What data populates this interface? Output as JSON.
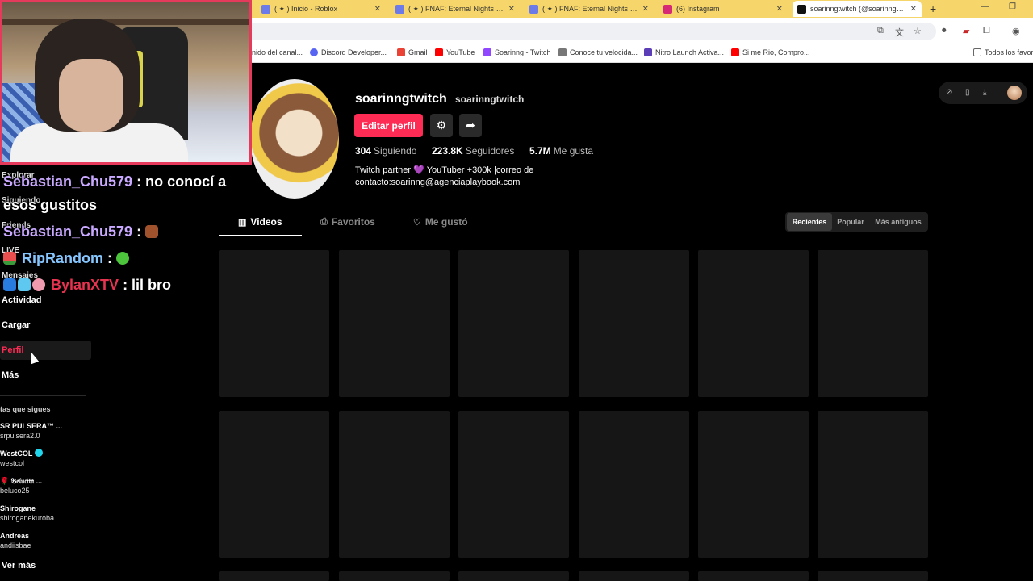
{
  "browser": {
    "tabs": [
      {
        "title": "( ✦ ) Inicio - Roblox",
        "color": "#6c7be8",
        "active": false
      },
      {
        "title": "( ✦ ) FNAF: Eternal Nights 🦇 - ",
        "color": "#6c7be8",
        "active": false
      },
      {
        "title": "( ✦ ) FNAF: Eternal Nights 🦇 - ",
        "color": "#6c7be8",
        "active": false
      },
      {
        "title": "(6) Instagram",
        "color": "#d62976",
        "active": false
      },
      {
        "title": "soarinngtwitch (@soarinngtwit",
        "color": "#111111",
        "active": true
      }
    ],
    "new_tab": "+",
    "bookmarks": [
      {
        "label": "nido del canal...",
        "color": "#ffffff"
      },
      {
        "label": "Discord Developer...",
        "color": "#5865f2"
      },
      {
        "label": "Gmail",
        "color": "#ea4335"
      },
      {
        "label": "YouTube",
        "color": "#ff0000"
      },
      {
        "label": "Soarinng - Twitch",
        "color": "#9146ff"
      },
      {
        "label": "Conoce tu velocida...",
        "color": "#777777"
      },
      {
        "label": "Nitro Launch Activa...",
        "color": "#5b3db8"
      },
      {
        "label": "Si me Rio, Compro...",
        "color": "#ff0000"
      },
      {
        "label": "Todos los favori",
        "color": "#777777"
      }
    ]
  },
  "chat": [
    {
      "user": "Sebastian_Chu579",
      "text": ": no conocí a",
      "color": "purple"
    },
    {
      "user": "",
      "text": "esos gustitos",
      "color": "purple"
    },
    {
      "user": "Sebastian_Chu579",
      "text": ":",
      "color": "purple"
    },
    {
      "user": "RipRandom",
      "text": ":",
      "color": "blue"
    },
    {
      "user": "BylanXTV",
      "text": ": lil bro",
      "color": "red"
    }
  ],
  "sidebar": {
    "items": [
      {
        "label": "Explorar"
      },
      {
        "label": "Siguiendo"
      },
      {
        "label": "Friends"
      },
      {
        "label": "LIVE"
      },
      {
        "label": "Mensajes"
      },
      {
        "label": "Actividad"
      },
      {
        "label": "Cargar"
      },
      {
        "label": "Perfil"
      },
      {
        "label": "Más"
      }
    ],
    "following_title": "tas que sigues",
    "following": [
      {
        "name": "SR PULSERA™ ...",
        "handle": "srpulsera2.0"
      },
      {
        "name": "WestCOL",
        "handle": "westcol"
      },
      {
        "name": "🌹 𝔅𝔢𝔩𝔲𝔠𝔦𝔱𝔞 ...",
        "handle": "beluco25"
      },
      {
        "name": "Shirogane",
        "handle": "shiroganekuroba"
      },
      {
        "name": "Andreas",
        "handle": "andiisbae"
      }
    ],
    "see_more": "Ver más"
  },
  "profile": {
    "username": "soarinngtwitch",
    "nickname": "soarinngtwitch",
    "edit_label": "Editar perfil",
    "stats": [
      {
        "num": "304",
        "label": "Siguiendo"
      },
      {
        "num": "223.8K",
        "label": "Seguidores"
      },
      {
        "num": "5.7M",
        "label": "Me gusta"
      }
    ],
    "bio_line1": "Twitch partner 💜 YouTuber +300k |correo de",
    "bio_line2": "contacto:soarinng@agenciaplaybook.com",
    "tabs": [
      {
        "label": "Videos",
        "icon": "▥"
      },
      {
        "label": "Favoritos",
        "icon": "⎙"
      },
      {
        "label": "Me gustó",
        "icon": "♡"
      }
    ],
    "sort": [
      {
        "label": "Recientes",
        "active": true
      },
      {
        "label": "Popular",
        "active": false
      },
      {
        "label": "Más antiguos",
        "active": false
      }
    ]
  }
}
